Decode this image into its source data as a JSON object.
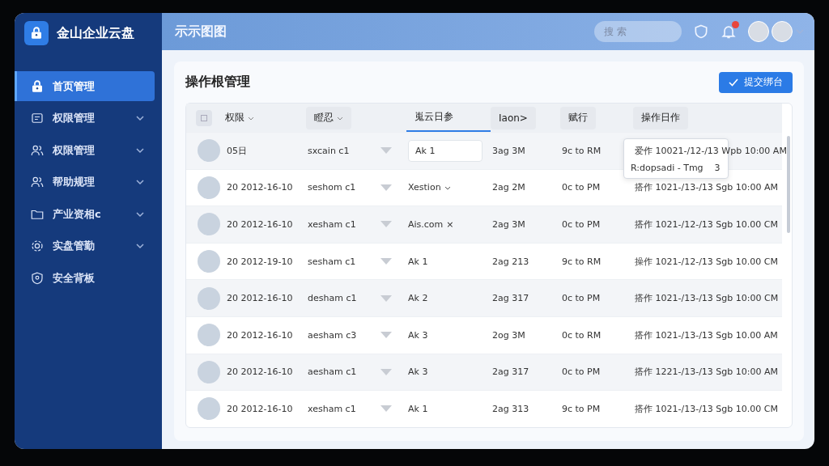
{
  "sidebar": {
    "brand": "金山企业云盘",
    "items": [
      {
        "label": "首页管理",
        "kind": "lock",
        "selected": true,
        "expandable": false
      },
      {
        "label": "权限管理",
        "kind": "doc",
        "selected": false,
        "expandable": true
      },
      {
        "label": "权限管理",
        "kind": "users",
        "selected": false,
        "expandable": true
      },
      {
        "label": "帮助规理",
        "kind": "users",
        "selected": false,
        "expandable": true
      },
      {
        "label": "产业资相c",
        "kind": "folder",
        "selected": false,
        "expandable": true
      },
      {
        "label": "实盘管勤",
        "kind": "gear",
        "selected": false,
        "expandable": true
      },
      {
        "label": "安全背板",
        "kind": "shield",
        "selected": false,
        "expandable": false
      }
    ]
  },
  "header": {
    "title": "示示图图",
    "search": {
      "placeholder": "搜 索"
    },
    "notifications_badge": true
  },
  "card": {
    "title": "操作根管理",
    "action_button": "提交绑台"
  },
  "table": {
    "select_all": {
      "checked": false
    },
    "columns": [
      {
        "label": "权限",
        "sortable": true,
        "selected": false
      },
      {
        "label": "瞪忍",
        "sortable": true,
        "selected": false
      },
      {
        "label": "嵬云日参",
        "sortable": false,
        "selected": true
      },
      {
        "label": "Iaon>",
        "sortable": false,
        "selected": false
      },
      {
        "label": "赋行",
        "sortable": false,
        "selected": false
      },
      {
        "label": "操作日作",
        "sortable": false,
        "selected": false
      }
    ],
    "rows": [
      {
        "column_1": "05日",
        "column_2": "sxcain c1",
        "column_3": {
          "kind": "field",
          "text": "Ak 1"
        },
        "column_4": "3ag 3M",
        "column_5": "9c to RM",
        "column_6": "爱作 10021-/12-/13 Wpb 10:00 AM",
        "tooltip": [
          "R:dopsadi - Tmg",
          "3"
        ]
      },
      {
        "column_1": "20 2012-16-10",
        "column_2": "seshom c1",
        "column_3": {
          "kind": "select",
          "text": "Xestion"
        },
        "column_4": "2ag 2M",
        "column_5": "0c to PM",
        "column_6": "搭作 1021-/13-/13 Sgb 10:00 AM"
      },
      {
        "column_1": "20 2012-16-10",
        "column_2": "xesham c1",
        "column_3": {
          "kind": "chip",
          "text": "Ais.com",
          "remove": "×"
        },
        "column_4": "2ag 3M",
        "column_5": "0c to PM",
        "column_6": "搭作 1021-/12-/13 Sgb 10.00 CM"
      },
      {
        "column_1": "20 2012-19-10",
        "column_2": "sesham c1",
        "column_3": {
          "kind": "text",
          "text": "Ak 1"
        },
        "column_4": "2ag 213",
        "column_5": "9c to RM",
        "column_6": "操作 1021-/12-/13 Sgb 10.00 CM"
      },
      {
        "column_1": "20 2012-16-10",
        "column_2": "desham c1",
        "column_3": {
          "kind": "text",
          "text": "Ak 2"
        },
        "column_4": "2ag 317",
        "column_5": "0c to PM",
        "column_6": "搭作 1021-/13-/13 Sgb 10:00 CM"
      },
      {
        "column_1": "20 2012-16-10",
        "column_2": "aesham c3",
        "column_3": {
          "kind": "text",
          "text": "Ak 3"
        },
        "column_4": "2og 3M",
        "column_5": "0c to RM",
        "column_6": "搭作 1021-/13-/13 Sgb 10.00 AM"
      },
      {
        "column_1": "20 2012-16-10",
        "column_2": "aesham c1",
        "column_3": {
          "kind": "text",
          "text": "Ak 3"
        },
        "column_4": "2ag 317",
        "column_5": "0c to PM",
        "column_6": "搭作 1221-/13-/13 Sgb 10:00 AM"
      },
      {
        "column_1": "20 2012-16-10",
        "column_2": "xesham c1",
        "column_3": {
          "kind": "text",
          "text": "Ak 1"
        },
        "column_4": "2ag 313",
        "column_5": "9c to PM",
        "column_6": "搭作 1021-/13-/13 Sgb 10.00 CM"
      }
    ]
  }
}
